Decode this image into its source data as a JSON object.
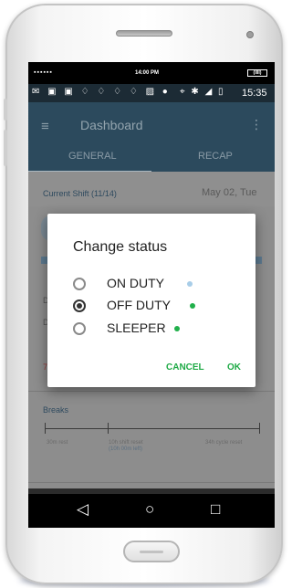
{
  "device": {
    "top_status": {
      "signal_dots": "▪▪▪▪▪▪",
      "time": "14:00 PM",
      "battery": "(IIII)"
    },
    "android_status": {
      "clock": "15:35",
      "left_icons": "✉ ▣ ▣ ♢ ♢ ♢ ♢ ▨ ●",
      "right_icons": "⌖ ✱ ◢ ▯"
    }
  },
  "appbar": {
    "menu_icon": "≡",
    "title": "Dashboard",
    "more_icon": "⋮",
    "tabs": [
      {
        "label": "GENERAL",
        "selected": true
      },
      {
        "label": "RECAP",
        "selected": false
      }
    ]
  },
  "dashboard": {
    "current_shift": "Current Shift (11/14)",
    "date": "May 02, Tue",
    "partial_labels": [
      "D",
      "D",
      "7"
    ],
    "breaks": {
      "title": "Breaks",
      "labels": [
        "30m rest",
        "10h shift reset",
        "34h cycle reset"
      ],
      "sub_label": "(10h 00m left)"
    }
  },
  "dialog": {
    "title": "Change status",
    "options": [
      {
        "label": "ON DUTY",
        "checked": false,
        "dot_color": "#a8cde8"
      },
      {
        "label": "OFF DUTY",
        "checked": true,
        "dot_color": "#21b04b"
      },
      {
        "label": "SLEEPER",
        "checked": false,
        "dot_color": "#21b04b"
      }
    ],
    "cancel_label": "CANCEL",
    "ok_label": "OK",
    "action_color": "#1faa46"
  },
  "navbar": {
    "back_icon": "◁",
    "home_icon": "○",
    "recents_icon": "□"
  },
  "colors": {
    "appbar": "#2c4a5d",
    "scrim": "#8d8d8d",
    "accent": "#1faa46"
  }
}
